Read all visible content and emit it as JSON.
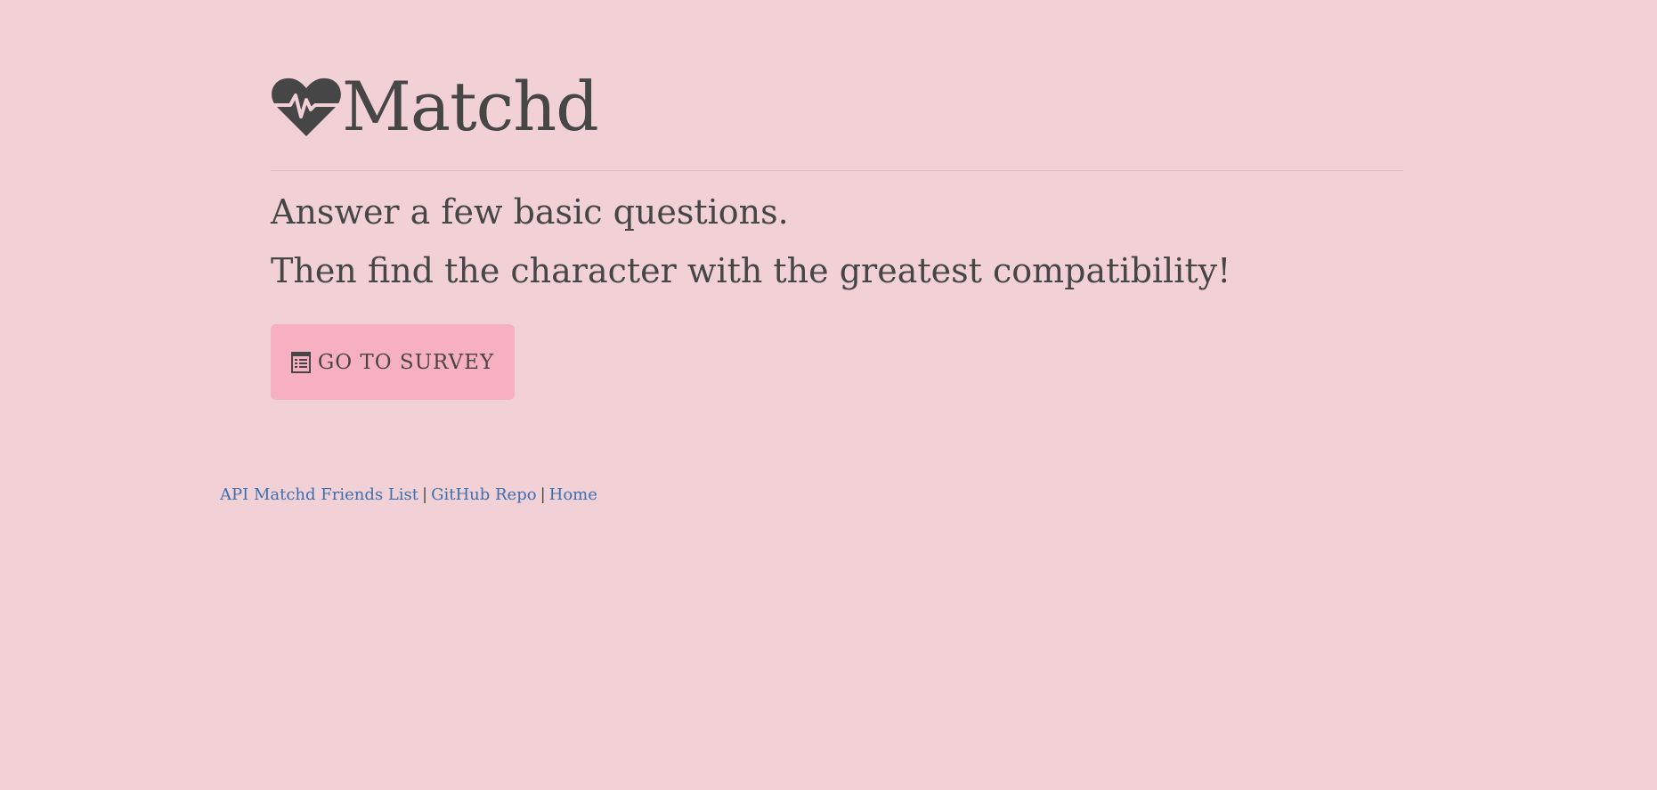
{
  "brand": {
    "icon": "heartbeat-icon",
    "title": "Matchd"
  },
  "intro": {
    "line1": "Answer a few basic questions.",
    "line2": "Then find the character with the greatest compatibility!"
  },
  "survey_button": {
    "icon": "list-icon",
    "label": "GO TO SURVEY"
  },
  "footer": {
    "links": [
      {
        "label": "API Matchd Friends List"
      },
      {
        "label": "GitHub Repo"
      },
      {
        "label": "Home"
      }
    ],
    "separator": "|"
  },
  "colors": {
    "background": "#f2d1d6",
    "button": "#f7b0c1",
    "text": "#464646",
    "link": "#3a6fb0"
  }
}
